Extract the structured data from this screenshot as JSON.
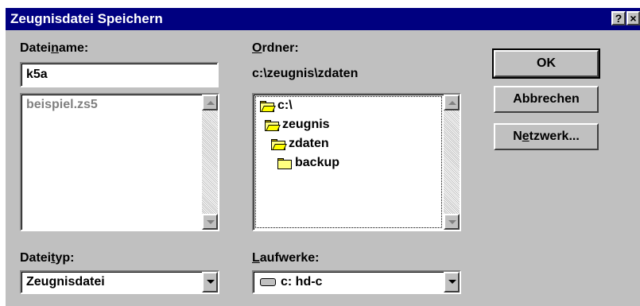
{
  "dialog": {
    "title": "Zeugnisdatei Speichern",
    "help_button": "?",
    "close_button": "×"
  },
  "filename": {
    "label_pre": "Datei",
    "label_ul": "n",
    "label_post": "ame:",
    "value": "k5a",
    "files": [
      "beispiel.zs5"
    ]
  },
  "folder": {
    "label_ul": "O",
    "label_post": "rdner:",
    "path": "c:\\zeugnis\\zdaten",
    "tree": [
      {
        "name": "c:\\",
        "icon": "open-folder-icon"
      },
      {
        "name": "zeugnis",
        "icon": "open-folder-icon"
      },
      {
        "name": "zdaten",
        "icon": "open-folder-icon"
      },
      {
        "name": "backup",
        "icon": "folder-icon"
      }
    ]
  },
  "filetype": {
    "label_pre": "Datei",
    "label_ul": "t",
    "label_post": "yp:",
    "value": "Zeugnisdatei"
  },
  "drives": {
    "label_ul": "L",
    "label_post": "aufwerke:",
    "value": "c: hd-c",
    "icon": "hard-drive-icon"
  },
  "buttons": {
    "ok": "OK",
    "cancel": "Abbrechen",
    "network_pre": "N",
    "network_ul": "e",
    "network_post": "tzwerk..."
  }
}
